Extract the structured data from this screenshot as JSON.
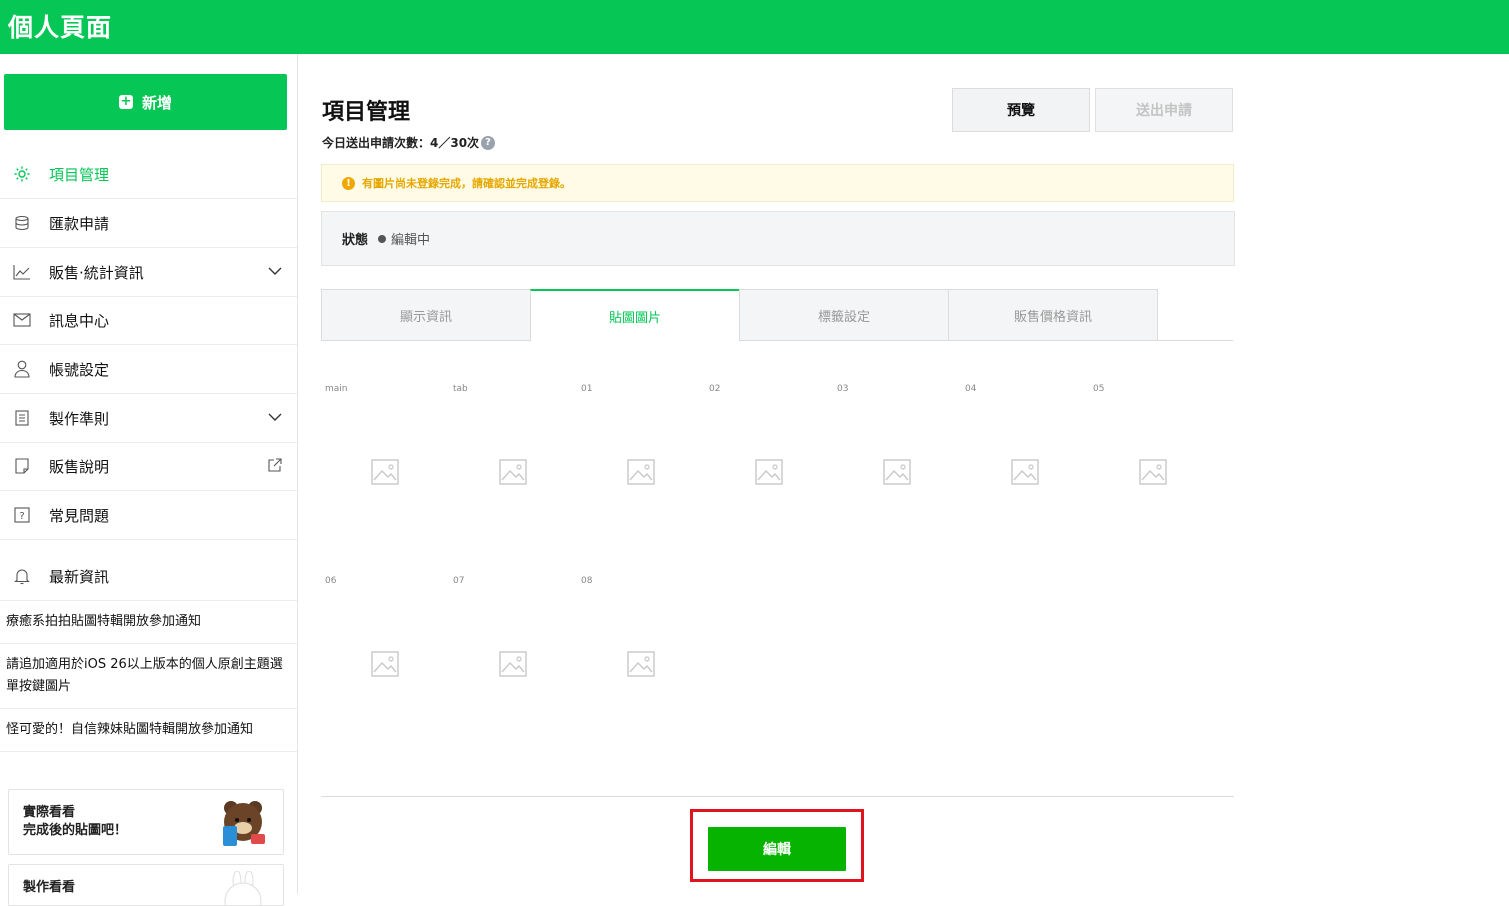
{
  "header": {
    "title": "個人頁面"
  },
  "sidebar": {
    "add_button": "新增",
    "nav": [
      {
        "label": "項目管理",
        "icon": "gear-icon",
        "active": true
      },
      {
        "label": "匯款申請",
        "icon": "database-icon"
      },
      {
        "label": "販售‧統計資訊",
        "icon": "chart-icon",
        "expandable": true
      },
      {
        "label": "訊息中心",
        "icon": "mail-icon"
      },
      {
        "label": "帳號設定",
        "icon": "user-icon"
      },
      {
        "label": "製作準則",
        "icon": "document-icon",
        "expandable": true
      },
      {
        "label": "販售說明",
        "icon": "note-icon",
        "external": true
      },
      {
        "label": "常見問題",
        "icon": "question-icon"
      }
    ],
    "news_title": "最新資訊",
    "news": [
      "療癒系拍拍貼圖特輯開放參加通知",
      "請追加適用於iOS 26以上版本的個人原創主題選單按鍵圖片",
      "怪可愛的！自信辣妹貼圖特輯開放參加通知"
    ],
    "promos": [
      {
        "line1": "實際看看",
        "line2": "完成後的貼圖吧！"
      },
      {
        "line1": "製作看看",
        "line2": ""
      }
    ]
  },
  "main": {
    "title": "項目管理",
    "quota": "今日送出申請次數：4／30次",
    "preview_button": "預覽",
    "submit_button": "送出申請",
    "warning": "有圖片尚未登錄完成，請確認並完成登錄。",
    "status_label": "狀態",
    "status_value": "編輯中",
    "tabs": [
      "顯示資訊",
      "貼圖圖片",
      "標籤設定",
      "販售價格資訊"
    ],
    "active_tab": 1,
    "images_row1": [
      "main",
      "tab",
      "01",
      "02",
      "03",
      "04",
      "05"
    ],
    "images_row2": [
      "06",
      "07",
      "08"
    ],
    "edit_button": "編輯"
  },
  "colors": {
    "brand": "#06c755",
    "edit_button": "#06b400",
    "highlight": "#e0141e"
  }
}
